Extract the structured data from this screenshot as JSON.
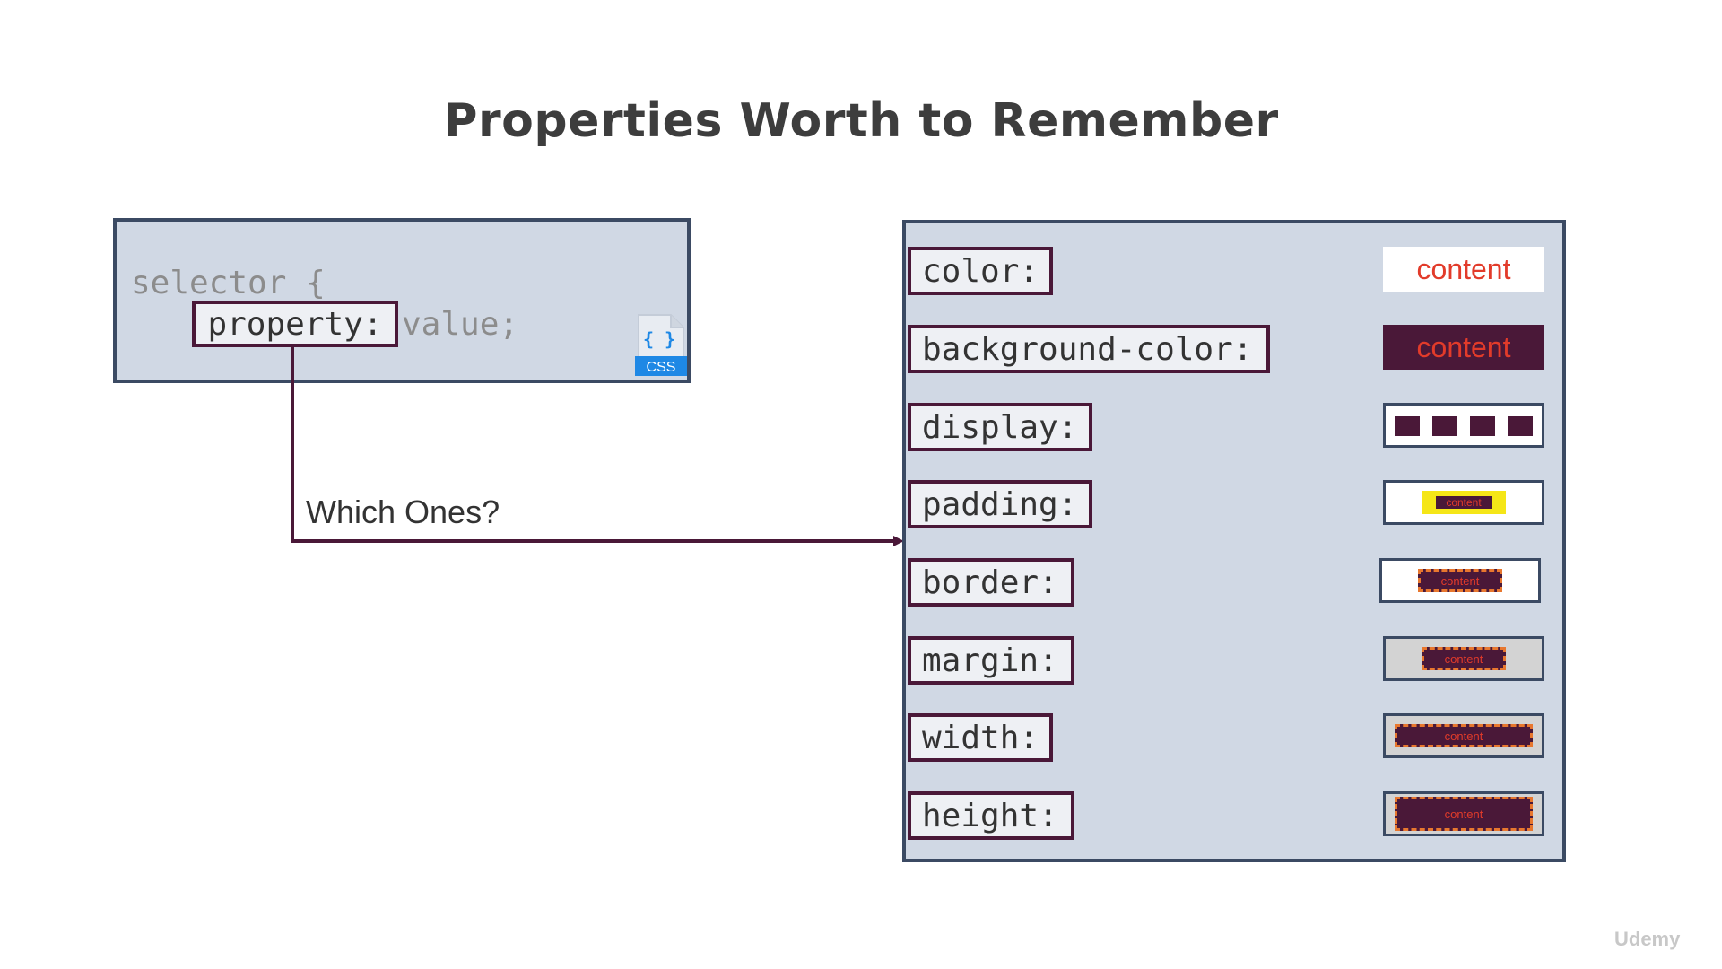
{
  "title": "Properties Worth to Remember",
  "code": {
    "selector": "selector {",
    "property": "property:",
    "value": "value;",
    "icon_label": "CSS",
    "icon_braces": "{ }"
  },
  "connector_label": "Which Ones?",
  "properties": [
    {
      "label": "color:",
      "demo": "content"
    },
    {
      "label": "background-color:",
      "demo": "content"
    },
    {
      "label": "display:",
      "demo": ""
    },
    {
      "label": "padding:",
      "demo": "content"
    },
    {
      "label": "border:",
      "demo": "content"
    },
    {
      "label": "margin:",
      "demo": "content"
    },
    {
      "label": "width:",
      "demo": "content"
    },
    {
      "label": "height:",
      "demo": "content"
    }
  ],
  "watermark": "Udemy",
  "colors": {
    "panel": "#d0d8e4",
    "frame": "#3b4a63",
    "accent": "#4a1838",
    "text_red": "#e23b2a",
    "padding_yellow": "#f5e617",
    "dashed_orange": "#e8772e"
  }
}
